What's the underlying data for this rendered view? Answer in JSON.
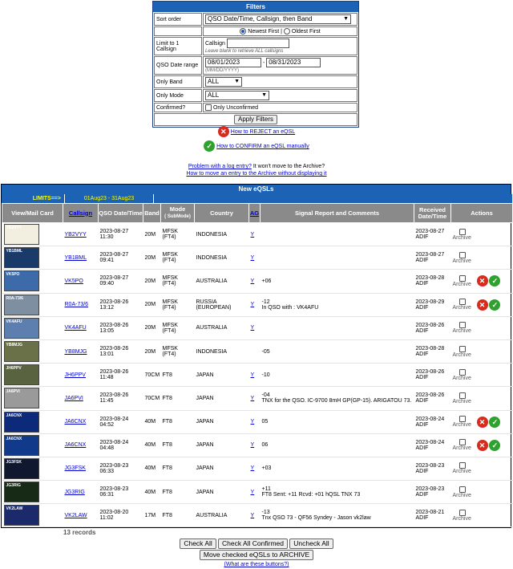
{
  "filters": {
    "title": "Filters",
    "sort_label": "Sort order",
    "sort_value": "QSO Date/Time, Callsign, then Band",
    "newest": "Newest First",
    "sep": "|",
    "oldest": "Oldest First",
    "limit_label": "Limit to 1 Callsign",
    "callsign_label": "Callsign",
    "callsign_hint": "Leave blank to retrieve ALL callsigns",
    "date_label": "QSO Date range",
    "date_from": "08/01/2023",
    "date_dash": "-",
    "date_to": "08/31/2023",
    "date_fmt": "(MM/DD/YYYY)",
    "band_label": "Only Band",
    "band_value": "ALL",
    "mode_label": "Only Mode",
    "mode_value": "ALL",
    "confirmed_label": "Confirmed?",
    "unconfirmed": "Only Unconfirmed",
    "apply": "Apply Filters"
  },
  "help": {
    "reject": "How to REJECT an eQSL",
    "confirm": "How to CONFIRM an eQSL manually",
    "problem_link": "Problem with a log entry?",
    "problem_text": " It won't move to the Archive?",
    "archive_link": "How to move an entry to the Archive without displaying it"
  },
  "main": {
    "title": "New eQSLs",
    "limits": "LIMITS==>",
    "limits_range": "01Aug23 - 31Aug23",
    "headers": {
      "view": "View/Mail Card",
      "callsign": "Callsign",
      "qso": "QSO Date/Time",
      "band": "Band",
      "mode": "Mode",
      "submode": "( SubMode)",
      "country": "Country",
      "ag": "AG",
      "report": "Signal Report and Comments",
      "received": "Received Date/Time",
      "actions": "Actions"
    },
    "rows": [
      {
        "thumb": "YB2VYY",
        "call": "YB2VYY",
        "date": "2023-08-27",
        "time": "11:30",
        "band": "20M",
        "mode": "MFSK (FT4)",
        "country": "INDONESIA",
        "ag": "Y",
        "r1": "",
        "r2": "",
        "rdate": "2023-08-27",
        "rsrc": "ADIF",
        "archive": "Archive",
        "rc": false
      },
      {
        "thumb": "YB1BML",
        "call": "YB1BML",
        "date": "2023-08-27",
        "time": "09:41",
        "band": "20M",
        "mode": "MFSK (FT4)",
        "country": "INDONESIA",
        "ag": "Y",
        "r1": "",
        "r2": "",
        "rdate": "2023-08-27",
        "rsrc": "ADIF",
        "archive": "Archive",
        "rc": false
      },
      {
        "thumb": "VK5PO",
        "call": "VK5PO",
        "date": "2023-08-27",
        "time": "09:40",
        "band": "20M",
        "mode": "MFSK (FT4)",
        "country": "AUSTRALIA",
        "ag": "Y",
        "r1": "+06",
        "r2": "",
        "rdate": "2023-08-28",
        "rsrc": "ADIF",
        "archive": "Archive",
        "rc": true
      },
      {
        "thumb": "R0A-73/6",
        "call": "R0A-73/6",
        "date": "2023-08-26",
        "time": "13:12",
        "band": "20M",
        "mode": "MFSK (FT4)",
        "country": "RUSSIA (EUROPEAN)",
        "ag": "Y",
        "r1": "-12",
        "r2": "In QSO with : VK4AFU",
        "rdate": "2023-08-29",
        "rsrc": "ADIF",
        "archive": "Archive",
        "rc": true
      },
      {
        "thumb": "VK4AFU",
        "call": "VK4AFU",
        "date": "2023-08-26",
        "time": "13:05",
        "band": "20M",
        "mode": "MFSK (FT4)",
        "country": "AUSTRALIA",
        "ag": "Y",
        "r1": "",
        "r2": "",
        "rdate": "2023-08-26",
        "rsrc": "ADIF",
        "archive": "Archive",
        "rc": false
      },
      {
        "thumb": "YB8MJG",
        "call": "YB8MJG",
        "date": "2023-08-26",
        "time": "13:01",
        "band": "20M",
        "mode": "MFSK (FT4)",
        "country": "INDONESIA",
        "ag": "",
        "r1": "-05",
        "r2": "",
        "rdate": "2023-08-28",
        "rsrc": "ADIF",
        "archive": "Archive",
        "rc": false
      },
      {
        "thumb": "JH6PPV",
        "call": "JH6PPV",
        "date": "2023-08-26",
        "time": "11:48",
        "band": "70CM",
        "mode": "FT8",
        "country": "JAPAN",
        "ag": "Y",
        "r1": "-10",
        "r2": "",
        "rdate": "2023-08-26",
        "rsrc": "ADIF",
        "archive": "Archive",
        "rc": false
      },
      {
        "thumb": "JA6PVI",
        "call": "JA6PVI",
        "date": "2023-08-26",
        "time": "11:45",
        "band": "70CM",
        "mode": "FT8",
        "country": "JAPAN",
        "ag": "Y",
        "r1": "-04",
        "r2": "TNX for the QSO. IC-9700 8mH GP(GP-15). ARIGATOU 73.",
        "rdate": "2023-08-26",
        "rsrc": "ADIF",
        "archive": "Archive",
        "rc": false
      },
      {
        "thumb": "JA6CNX",
        "call": "JA6CNX",
        "date": "2023-08-24",
        "time": "04:52",
        "band": "40M",
        "mode": "FT8",
        "country": "JAPAN",
        "ag": "Y",
        "r1": "05",
        "r2": "",
        "rdate": "2023-08-24",
        "rsrc": "ADIF",
        "archive": "Archive",
        "rc": true
      },
      {
        "thumb": "JA6CNX",
        "call": "JA6CNX",
        "date": "2023-08-24",
        "time": "04:48",
        "band": "40M",
        "mode": "FT8",
        "country": "JAPAN",
        "ag": "Y",
        "r1": "06",
        "r2": "",
        "rdate": "2023-08-24",
        "rsrc": "ADIF",
        "archive": "Archive",
        "rc": true
      },
      {
        "thumb": "JG3FSK",
        "call": "JG3FSK",
        "date": "2023-08-23",
        "time": "06:33",
        "band": "40M",
        "mode": "FT8",
        "country": "JAPAN",
        "ag": "Y",
        "r1": "+03",
        "r2": "",
        "rdate": "2023-08-23",
        "rsrc": "ADIF",
        "archive": "Archive",
        "rc": false
      },
      {
        "thumb": "JG3RIG",
        "call": "JG3RIG",
        "date": "2023-08-23",
        "time": "06:31",
        "band": "40M",
        "mode": "FT8",
        "country": "JAPAN",
        "ag": "Y",
        "r1": "+11",
        "r2": "FT8 Sent: +11 Rcvd: +01 hQSL TNX 73",
        "rdate": "2023-08-23",
        "rsrc": "ADIF",
        "archive": "Archive",
        "rc": false
      },
      {
        "thumb": "VK2LAW",
        "call": "VK2LAW",
        "date": "2023-08-20",
        "time": "11:02",
        "band": "17M",
        "mode": "FT8",
        "country": "AUSTRALIA",
        "ag": "Y",
        "r1": "-13",
        "r2": "Tnx QSO 73 - QF56 Syndey - Jason vk2law",
        "rdate": "2023-08-21",
        "rsrc": "ADIF",
        "archive": "Archive",
        "rc": false
      }
    ],
    "records": "13 records"
  },
  "bottom": {
    "check_all": "Check All",
    "check_confirmed": "Check All Confirmed",
    "uncheck_all": "Uncheck All",
    "move": "Move checked eQSLs to ARCHIVE",
    "what": "(What are these buttons?)"
  },
  "colors": {
    "header_blue": "#1c62b5",
    "limits_yellow": "#ffff00",
    "reject_red": "#d62b1e",
    "confirm_green": "#2fa12f",
    "column_header_gray": "#8a8a8a"
  },
  "thumb_colors": [
    "#f2efe0",
    "#1a3a6a",
    "#3d6aa8",
    "#7d8fa0",
    "#5c7fb0",
    "#6a7048",
    "#5a6340",
    "#9a9a9a",
    "#0d2a7a",
    "#123a8a",
    "#101830",
    "#162a16",
    "#1a2a6a"
  ]
}
